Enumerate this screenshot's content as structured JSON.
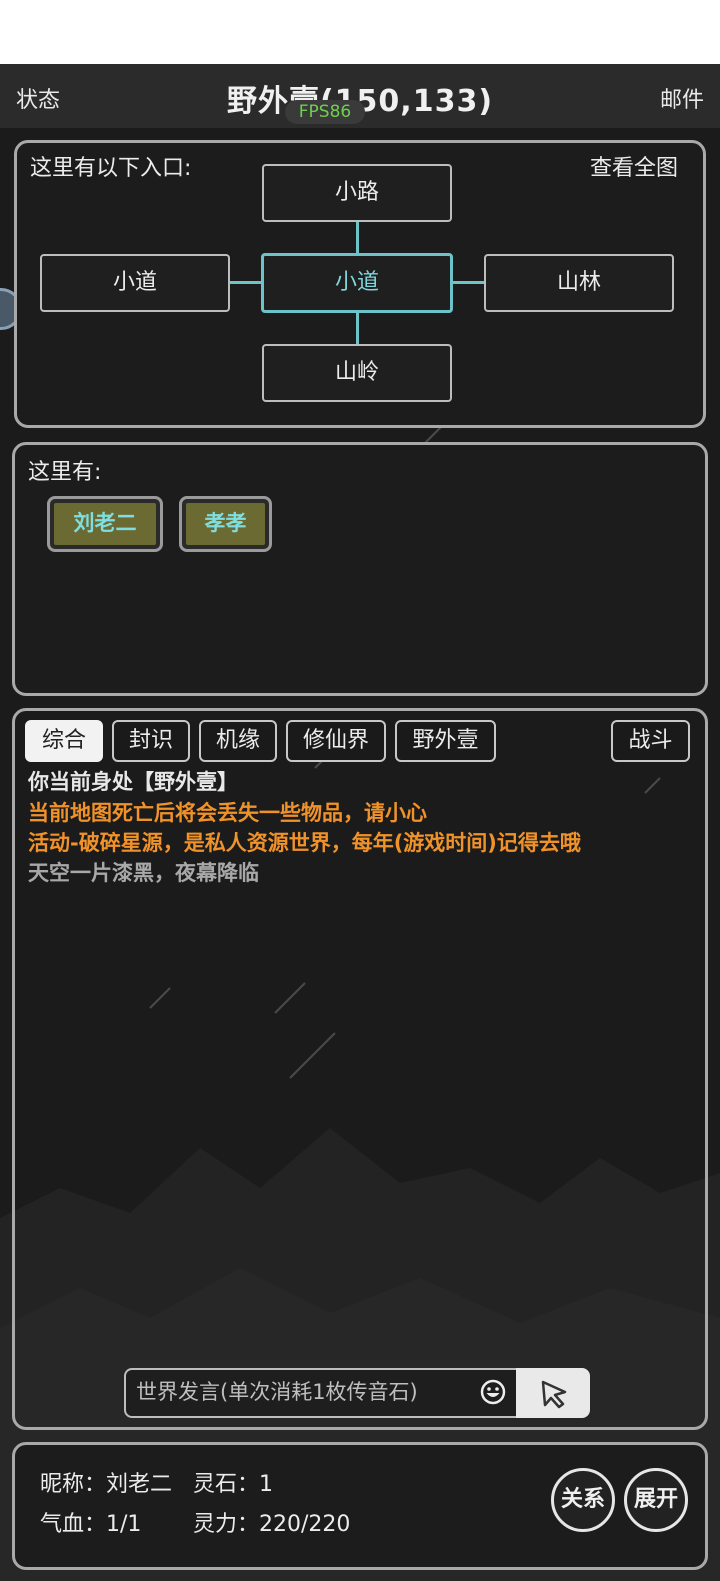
{
  "header": {
    "left": "状态",
    "title": "野外壹(150,133)",
    "right": "邮件",
    "fps": "FPS86"
  },
  "map": {
    "heading": "这里有以下入口:",
    "view_full": "查看全图",
    "north": "小路",
    "west": "小道",
    "center": "小道",
    "east": "山林",
    "south": "山岭"
  },
  "here": {
    "heading": "这里有:",
    "npcs": [
      "刘老二",
      "孝孝"
    ]
  },
  "chat": {
    "tabs": [
      "综合",
      "封识",
      "机缘",
      "修仙界",
      "野外壹"
    ],
    "battle_tab": "战斗",
    "messages": [
      {
        "text": "你当前身处【野外壹】",
        "color": "#e8e8e8"
      },
      {
        "text": "当前地图死亡后将会丢失一些物品，请小心",
        "color": "#f0922a"
      },
      {
        "text": "活动-破碎星源，是私人资源世界，每年(游戏时间)记得去哦",
        "color": "#f0922a"
      },
      {
        "text": "天空一片漆黑，夜幕降临",
        "color": "#a8a8a8"
      }
    ],
    "input_placeholder": "世界发言(单次消耗1枚传音石)"
  },
  "status": {
    "nickname": "昵称：刘老二",
    "spirit_stone": "灵石：1",
    "hp": "气血：1/1",
    "mana": "灵力：220/220",
    "relation_btn": "关系",
    "expand_btn": "展开"
  },
  "colors": {
    "accent_cyan": "#6cc3c8",
    "warning_orange": "#f0922a",
    "npc_bg": "#6b6a33"
  }
}
